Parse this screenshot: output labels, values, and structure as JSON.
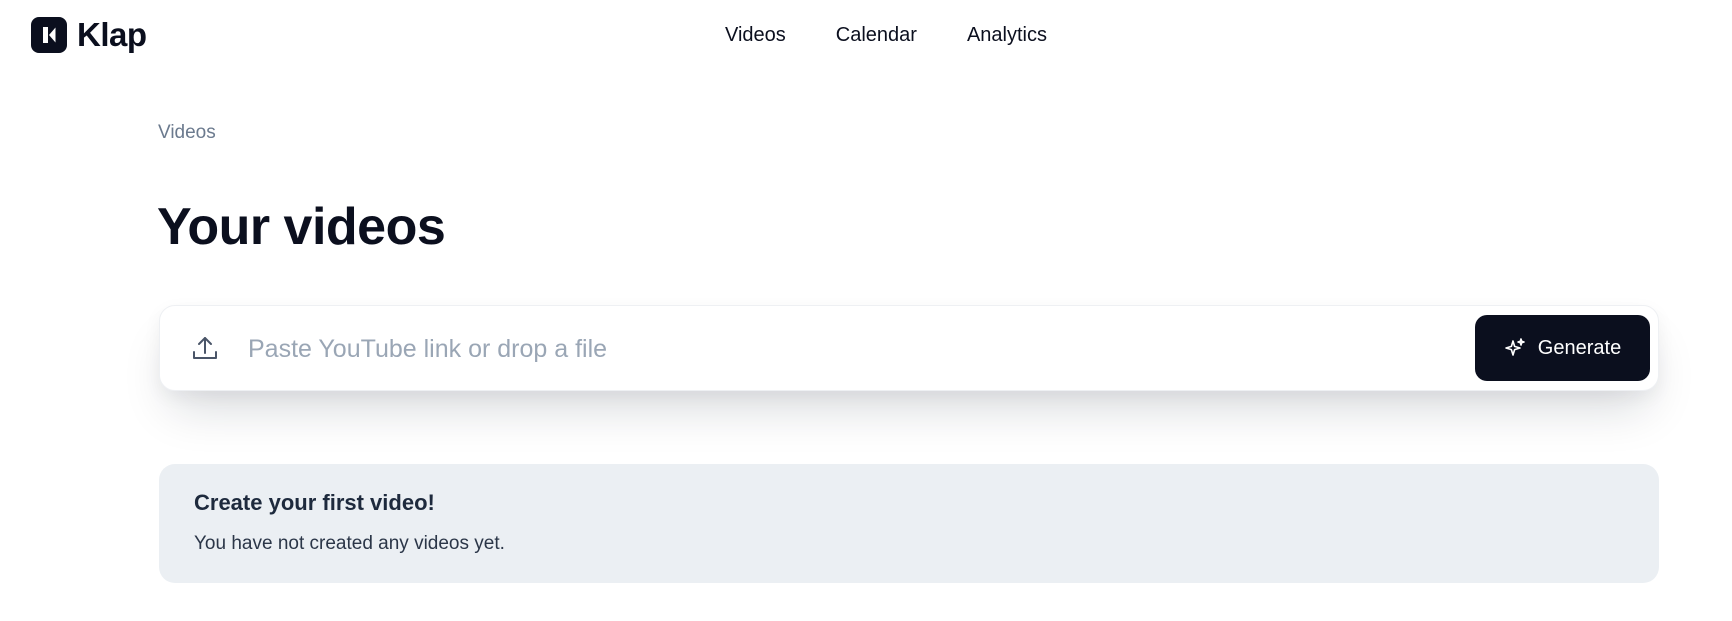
{
  "brand": {
    "name": "Klap",
    "logo_icon": "klap-logo-icon"
  },
  "nav": {
    "items": [
      {
        "label": "Videos"
      },
      {
        "label": "Calendar"
      },
      {
        "label": "Analytics"
      }
    ]
  },
  "breadcrumb": {
    "current": "Videos"
  },
  "page": {
    "title": "Your videos"
  },
  "input": {
    "placeholder": "Paste YouTube link or drop a file",
    "value": "",
    "icon": "upload-icon"
  },
  "generate": {
    "label": "Generate",
    "icon": "sparkle-icon"
  },
  "empty_state": {
    "title": "Create your first video!",
    "message": "You have not created any videos yet."
  },
  "colors": {
    "primary": "#0b0f1e",
    "muted_text": "#6b7a8e",
    "placeholder": "#9aa6b5",
    "empty_bg": "#ebeff3"
  }
}
